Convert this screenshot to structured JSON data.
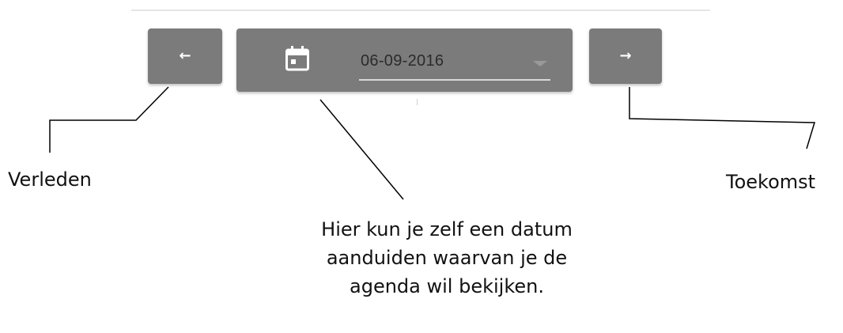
{
  "navigation": {
    "prev_icon": "←",
    "next_icon": "→",
    "date_value": "06-09-2016",
    "calendar_icon": "calendar-icon",
    "dropdown_icon": "dropdown-arrow-icon"
  },
  "annotations": {
    "past": "Verleden",
    "future": "Toekomst",
    "hint": "Hier kun je zelf een datum aanduiden waarvan je de agenda wil bekijken."
  }
}
